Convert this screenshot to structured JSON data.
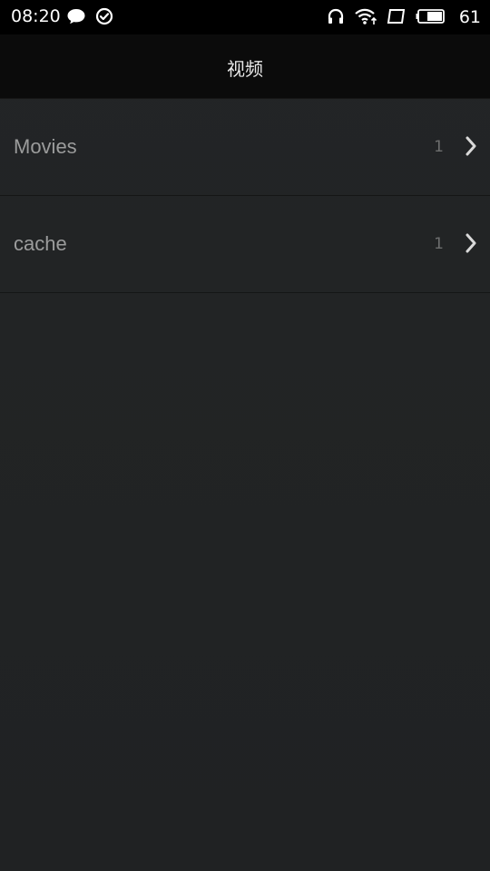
{
  "status_bar": {
    "time": "08:20",
    "left_icons": [
      "message-icon",
      "check-circle-icon"
    ],
    "right_icons": [
      "headphones-icon",
      "wifi-icon",
      "screen-icon",
      "battery-icon"
    ],
    "battery_level": "61"
  },
  "header": {
    "title": "视频"
  },
  "folders": [
    {
      "name": "Movies",
      "count": "1",
      "icon": "chevron-right-icon"
    },
    {
      "name": "cache",
      "count": "1",
      "icon": "chevron-right-icon"
    }
  ],
  "colors": {
    "status_bar_bg": "#000000",
    "title_bar_bg": "#0b0b0b",
    "list_bg": "#222324",
    "row_text": "#9b9c9c",
    "count_text": "#6d6e6e",
    "divider": "#151616"
  }
}
